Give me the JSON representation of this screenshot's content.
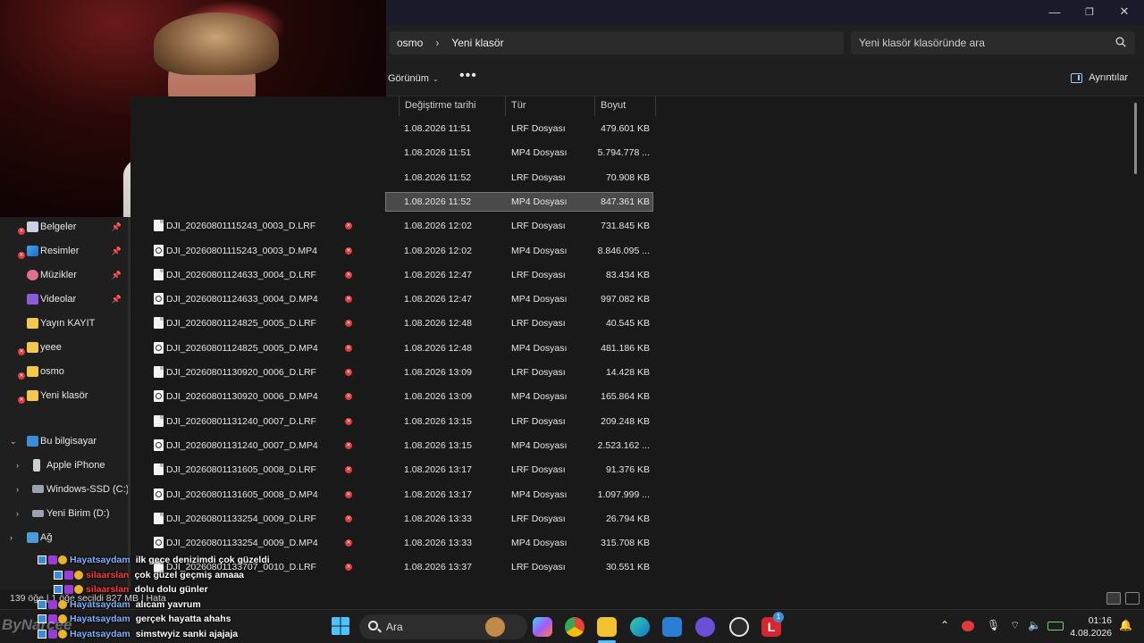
{
  "window": {
    "minimize": "—",
    "maximize": "❐",
    "close": "✕"
  },
  "address": {
    "crumbs": [
      "osmo",
      "Yeni klasör"
    ],
    "separator": "›",
    "search_placeholder": "Yeni klasör klasöründe ara"
  },
  "command_bar": {
    "view_label": "Görünüm",
    "more_label": "•••",
    "details_label": "Ayrıntılar"
  },
  "columns": {
    "date": "Değiştirme tarihi",
    "type": "Tür",
    "size": "Boyut"
  },
  "nav": {
    "items": [
      {
        "label": "Belgeler",
        "pinned": true,
        "sync_error": true
      },
      {
        "label": "Resimler",
        "pinned": true,
        "sync_error": true
      },
      {
        "label": "Müzikler",
        "pinned": true,
        "sync_error": false
      },
      {
        "label": "Videolar",
        "pinned": true,
        "sync_error": false
      },
      {
        "label": "Yayın KAYIT",
        "pinned": false,
        "sync_error": false
      },
      {
        "label": "yeee",
        "pinned": false,
        "sync_error": true
      },
      {
        "label": "osmo",
        "pinned": false,
        "sync_error": true
      },
      {
        "label": "Yeni klasör",
        "pinned": false,
        "sync_error": true
      }
    ],
    "pc": "Bu bilgisayar",
    "iphone": "Apple iPhone",
    "drive_c": "Windows-SSD (C:)",
    "drive_d": "Yeni Birim (D:)",
    "network": "Ağ",
    "pin_glyph": "📌"
  },
  "files": [
    {
      "name": "",
      "date": "1.08.2026 11:51",
      "type": "LRF Dosyası",
      "size": "479.601 KB"
    },
    {
      "name": "",
      "date": "1.08.2026 11:51",
      "type": "MP4 Dosyası",
      "size": "5.794.778 ..."
    },
    {
      "name": "",
      "date": "1.08.2026 11:52",
      "type": "LRF Dosyası",
      "size": "70.908 KB"
    },
    {
      "name": "",
      "date": "1.08.2026 11:52",
      "type": "MP4 Dosyası",
      "size": "847.361 KB"
    },
    {
      "name": "DJI_20260801115243_0003_D.LRF",
      "date": "1.08.2026 12:02",
      "type": "LRF Dosyası",
      "size": "731.845 KB"
    },
    {
      "name": "DJI_20260801115243_0003_D.MP4",
      "date": "1.08.2026 12:02",
      "type": "MP4 Dosyası",
      "size": "8.846.095 ..."
    },
    {
      "name": "DJI_20260801124633_0004_D.LRF",
      "date": "1.08.2026 12:47",
      "type": "LRF Dosyası",
      "size": "83.434 KB"
    },
    {
      "name": "DJI_20260801124633_0004_D.MP4",
      "date": "1.08.2026 12:47",
      "type": "MP4 Dosyası",
      "size": "997.082 KB"
    },
    {
      "name": "DJI_20260801124825_0005_D.LRF",
      "date": "1.08.2026 12:48",
      "type": "LRF Dosyası",
      "size": "40.545 KB"
    },
    {
      "name": "DJI_20260801124825_0005_D.MP4",
      "date": "1.08.2026 12:48",
      "type": "MP4 Dosyası",
      "size": "481.186 KB"
    },
    {
      "name": "DJI_20260801130920_0006_D.LRF",
      "date": "1.08.2026 13:09",
      "type": "LRF Dosyası",
      "size": "14.428 KB"
    },
    {
      "name": "DJI_20260801130920_0006_D.MP4",
      "date": "1.08.2026 13:09",
      "type": "MP4 Dosyası",
      "size": "165.864 KB"
    },
    {
      "name": "DJI_20260801131240_0007_D.LRF",
      "date": "1.08.2026 13:15",
      "type": "LRF Dosyası",
      "size": "209.248 KB"
    },
    {
      "name": "DJI_20260801131240_0007_D.MP4",
      "date": "1.08.2026 13:15",
      "type": "MP4 Dosyası",
      "size": "2.523.162 ..."
    },
    {
      "name": "DJI_20260801131605_0008_D.LRF",
      "date": "1.08.2026 13:17",
      "type": "LRF Dosyası",
      "size": "91.376 KB"
    },
    {
      "name": "DJI_20260801131605_0008_D.MP4",
      "date": "1.08.2026 13:17",
      "type": "MP4 Dosyası",
      "size": "1.097.999 ..."
    },
    {
      "name": "DJI_20260801133254_0009_D.LRF",
      "date": "1.08.2026 13:33",
      "type": "LRF Dosyası",
      "size": "26.794 KB"
    },
    {
      "name": "DJI_20260801133254_0009_D.MP4",
      "date": "1.08.2026 13:33",
      "type": "MP4 Dosyası",
      "size": "315.708 KB"
    },
    {
      "name": "DJI_20260801133707_0010_D.LRF",
      "date": "1.08.2026 13:37",
      "type": "LRF Dosyası",
      "size": "30.551 KB"
    }
  ],
  "status_bar": {
    "text": "139 öğe  |  1 öğe seçildi  827 MB  |  Hata"
  },
  "chat": [
    {
      "user": "Hayatsaydam",
      "user_color": "#7fb3ff",
      "text": "ilk gece denizimdi çok güzeldi"
    },
    {
      "user": "silaarslan",
      "user_color": "#ff3b3b",
      "text": "çok güzel geçmiş amaaa"
    },
    {
      "user": "silaarslan",
      "user_color": "#ff3b3b",
      "text": "dolu dolu günler"
    },
    {
      "user": "Hayatsaydam",
      "user_color": "#7fb3ff",
      "text": "alıcam yavrum"
    },
    {
      "user": "Hayatsaydam",
      "user_color": "#7fb3ff",
      "text": "gerçek hayatta ahahs"
    },
    {
      "user": "Hayatsaydam",
      "user_color": "#7fb3ff",
      "text": "simstwyiz sanki ajajaja"
    }
  ],
  "watermark": "ByNarcee",
  "taskbar": {
    "search_label": "Ara",
    "time": "01:16",
    "date": "4.08.2026",
    "badge_count": "1"
  },
  "colors": {
    "accent": "#4cc2ff",
    "error": "#e03a3a",
    "selection": "#4a4a4a"
  }
}
